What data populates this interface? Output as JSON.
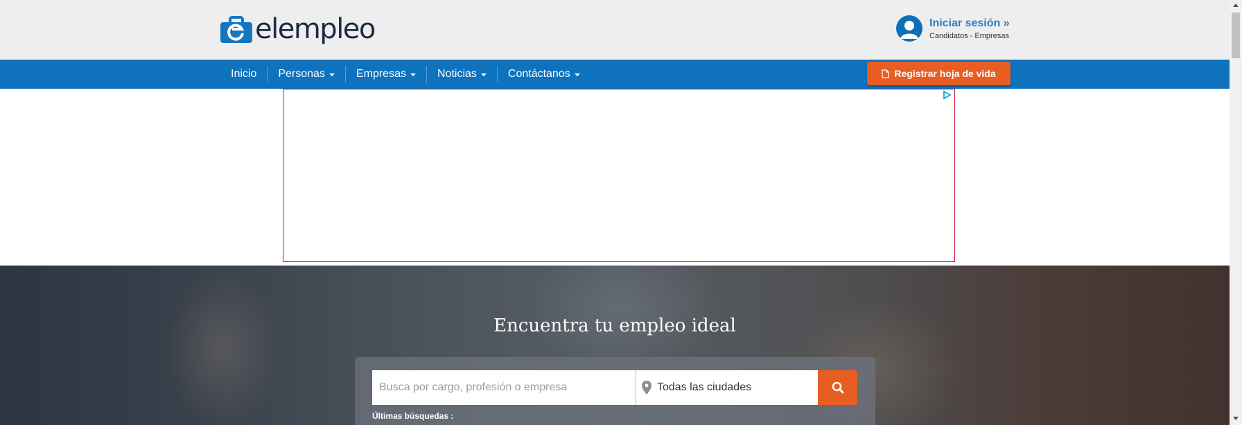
{
  "header": {
    "logo_text": "elempleo",
    "login_title": "Iniciar sesión »",
    "login_sub": "Candidatos - Empresas"
  },
  "nav": {
    "items": [
      {
        "label": "Inicio",
        "dropdown": false
      },
      {
        "label": "Personas",
        "dropdown": true
      },
      {
        "label": "Empresas",
        "dropdown": true
      },
      {
        "label": "Noticias",
        "dropdown": true
      },
      {
        "label": "Contáctanos",
        "dropdown": true
      }
    ],
    "register_label": "Registrar hoja de vida"
  },
  "hero": {
    "title": "Encuentra tu empleo ideal",
    "search_placeholder": "Busca por cargo, profesión o empresa",
    "city_value": "Todas las ciudades",
    "recent_label": "Últimas búsquedas :"
  },
  "colors": {
    "brand_blue": "#0e72bd",
    "accent_orange": "#e85d22",
    "header_bg": "#eeeeee"
  },
  "icons": [
    "logo-mark-icon",
    "user-avatar-icon",
    "document-icon",
    "adchoices-icon",
    "location-pin-icon",
    "search-icon"
  ]
}
